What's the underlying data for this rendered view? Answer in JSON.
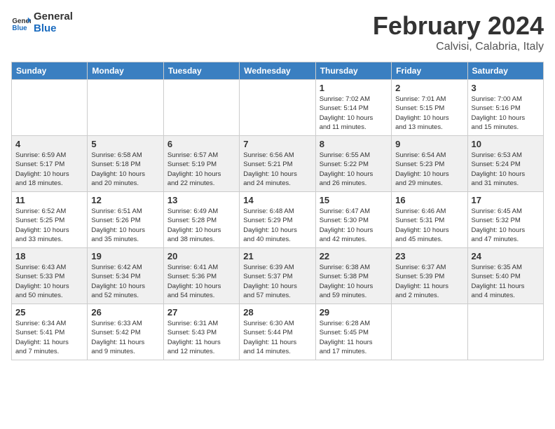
{
  "header": {
    "logo_line1": "General",
    "logo_line2": "Blue",
    "month": "February 2024",
    "location": "Calvisi, Calabria, Italy"
  },
  "weekdays": [
    "Sunday",
    "Monday",
    "Tuesday",
    "Wednesday",
    "Thursday",
    "Friday",
    "Saturday"
  ],
  "weeks": [
    [
      {
        "day": "",
        "info": ""
      },
      {
        "day": "",
        "info": ""
      },
      {
        "day": "",
        "info": ""
      },
      {
        "day": "",
        "info": ""
      },
      {
        "day": "1",
        "info": "Sunrise: 7:02 AM\nSunset: 5:14 PM\nDaylight: 10 hours\nand 11 minutes."
      },
      {
        "day": "2",
        "info": "Sunrise: 7:01 AM\nSunset: 5:15 PM\nDaylight: 10 hours\nand 13 minutes."
      },
      {
        "day": "3",
        "info": "Sunrise: 7:00 AM\nSunset: 5:16 PM\nDaylight: 10 hours\nand 15 minutes."
      }
    ],
    [
      {
        "day": "4",
        "info": "Sunrise: 6:59 AM\nSunset: 5:17 PM\nDaylight: 10 hours\nand 18 minutes."
      },
      {
        "day": "5",
        "info": "Sunrise: 6:58 AM\nSunset: 5:18 PM\nDaylight: 10 hours\nand 20 minutes."
      },
      {
        "day": "6",
        "info": "Sunrise: 6:57 AM\nSunset: 5:19 PM\nDaylight: 10 hours\nand 22 minutes."
      },
      {
        "day": "7",
        "info": "Sunrise: 6:56 AM\nSunset: 5:21 PM\nDaylight: 10 hours\nand 24 minutes."
      },
      {
        "day": "8",
        "info": "Sunrise: 6:55 AM\nSunset: 5:22 PM\nDaylight: 10 hours\nand 26 minutes."
      },
      {
        "day": "9",
        "info": "Sunrise: 6:54 AM\nSunset: 5:23 PM\nDaylight: 10 hours\nand 29 minutes."
      },
      {
        "day": "10",
        "info": "Sunrise: 6:53 AM\nSunset: 5:24 PM\nDaylight: 10 hours\nand 31 minutes."
      }
    ],
    [
      {
        "day": "11",
        "info": "Sunrise: 6:52 AM\nSunset: 5:25 PM\nDaylight: 10 hours\nand 33 minutes."
      },
      {
        "day": "12",
        "info": "Sunrise: 6:51 AM\nSunset: 5:26 PM\nDaylight: 10 hours\nand 35 minutes."
      },
      {
        "day": "13",
        "info": "Sunrise: 6:49 AM\nSunset: 5:28 PM\nDaylight: 10 hours\nand 38 minutes."
      },
      {
        "day": "14",
        "info": "Sunrise: 6:48 AM\nSunset: 5:29 PM\nDaylight: 10 hours\nand 40 minutes."
      },
      {
        "day": "15",
        "info": "Sunrise: 6:47 AM\nSunset: 5:30 PM\nDaylight: 10 hours\nand 42 minutes."
      },
      {
        "day": "16",
        "info": "Sunrise: 6:46 AM\nSunset: 5:31 PM\nDaylight: 10 hours\nand 45 minutes."
      },
      {
        "day": "17",
        "info": "Sunrise: 6:45 AM\nSunset: 5:32 PM\nDaylight: 10 hours\nand 47 minutes."
      }
    ],
    [
      {
        "day": "18",
        "info": "Sunrise: 6:43 AM\nSunset: 5:33 PM\nDaylight: 10 hours\nand 50 minutes."
      },
      {
        "day": "19",
        "info": "Sunrise: 6:42 AM\nSunset: 5:34 PM\nDaylight: 10 hours\nand 52 minutes."
      },
      {
        "day": "20",
        "info": "Sunrise: 6:41 AM\nSunset: 5:36 PM\nDaylight: 10 hours\nand 54 minutes."
      },
      {
        "day": "21",
        "info": "Sunrise: 6:39 AM\nSunset: 5:37 PM\nDaylight: 10 hours\nand 57 minutes."
      },
      {
        "day": "22",
        "info": "Sunrise: 6:38 AM\nSunset: 5:38 PM\nDaylight: 10 hours\nand 59 minutes."
      },
      {
        "day": "23",
        "info": "Sunrise: 6:37 AM\nSunset: 5:39 PM\nDaylight: 11 hours\nand 2 minutes."
      },
      {
        "day": "24",
        "info": "Sunrise: 6:35 AM\nSunset: 5:40 PM\nDaylight: 11 hours\nand 4 minutes."
      }
    ],
    [
      {
        "day": "25",
        "info": "Sunrise: 6:34 AM\nSunset: 5:41 PM\nDaylight: 11 hours\nand 7 minutes."
      },
      {
        "day": "26",
        "info": "Sunrise: 6:33 AM\nSunset: 5:42 PM\nDaylight: 11 hours\nand 9 minutes."
      },
      {
        "day": "27",
        "info": "Sunrise: 6:31 AM\nSunset: 5:43 PM\nDaylight: 11 hours\nand 12 minutes."
      },
      {
        "day": "28",
        "info": "Sunrise: 6:30 AM\nSunset: 5:44 PM\nDaylight: 11 hours\nand 14 minutes."
      },
      {
        "day": "29",
        "info": "Sunrise: 6:28 AM\nSunset: 5:45 PM\nDaylight: 11 hours\nand 17 minutes."
      },
      {
        "day": "",
        "info": ""
      },
      {
        "day": "",
        "info": ""
      }
    ]
  ]
}
